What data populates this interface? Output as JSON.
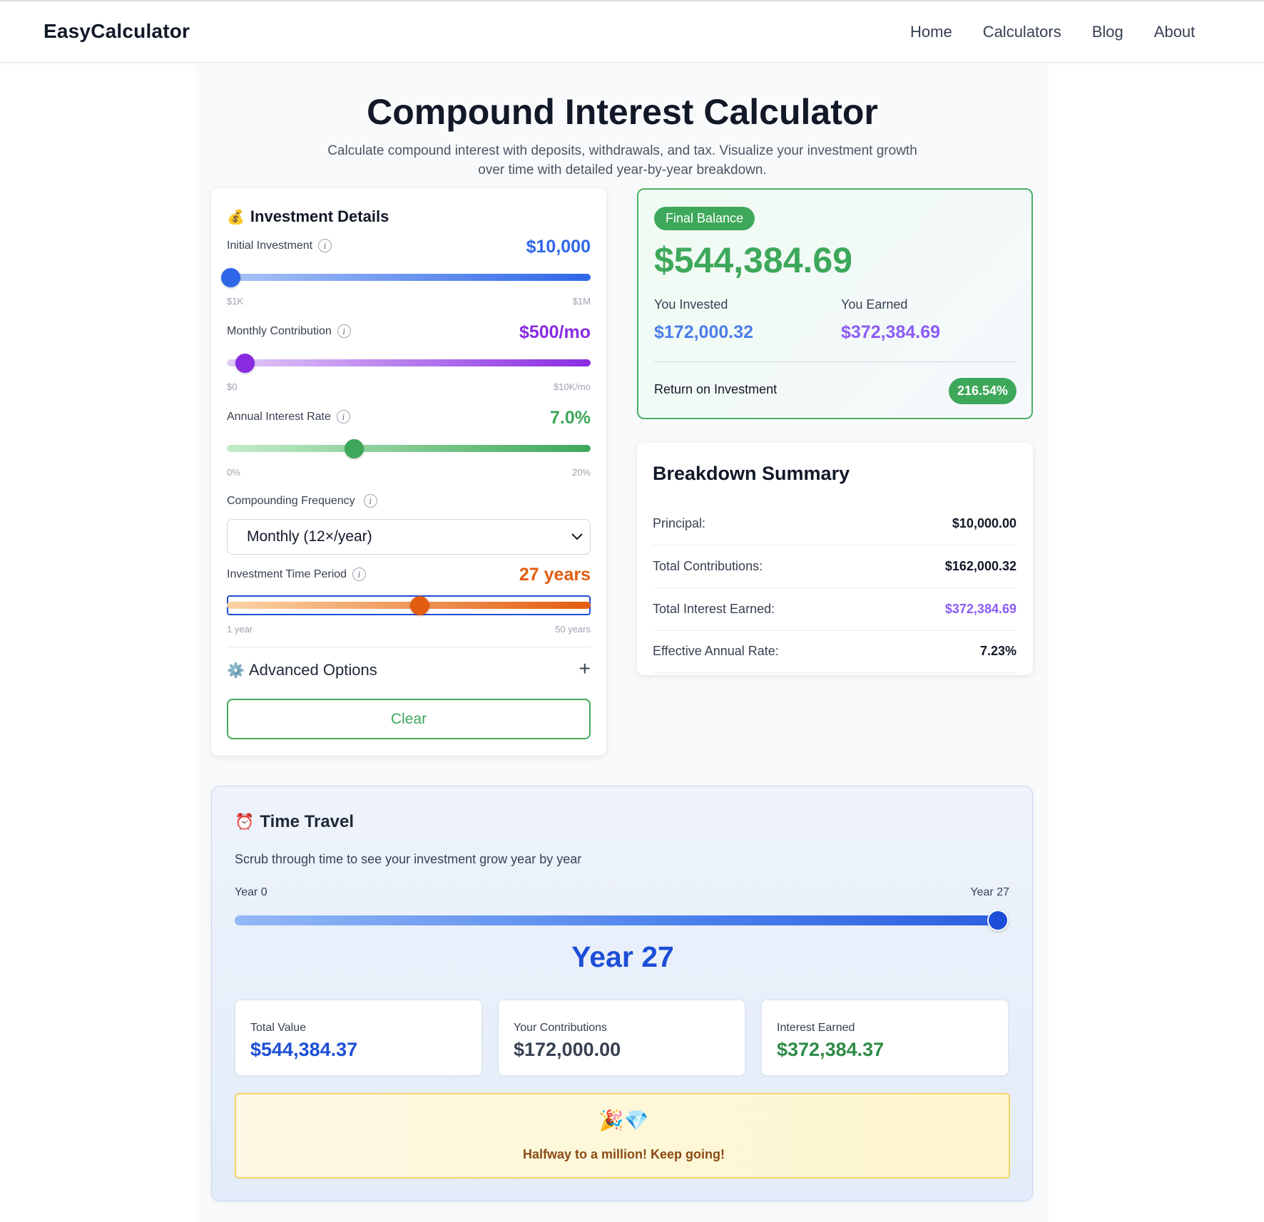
{
  "nav": {
    "brand": "EasyCalculator",
    "links": [
      "Home",
      "Calculators",
      "Blog",
      "About"
    ]
  },
  "header": {
    "title": "Compound Interest Calculator",
    "subtitle_line1": "Calculate compound interest with deposits, withdrawals, and tax. Visualize your investment growth",
    "subtitle_line2": "over time with detailed year-by-year breakdown."
  },
  "investment": {
    "title_emoji": "💰",
    "title": "Investment Details",
    "initial": {
      "label": "Initial Investment",
      "value": "$10,000",
      "min": "$1K",
      "max": "$1M",
      "fraction": 0.01,
      "color": "#2f66e8"
    },
    "monthly": {
      "label": "Monthly Contribution",
      "value": "$500/mo",
      "min": "$0",
      "max": "$10K/mo",
      "fraction": 0.05,
      "color": "#8a2be2"
    },
    "rate": {
      "label": "Annual Interest Rate",
      "value": "7.0%",
      "min": "0%",
      "max": "20%",
      "fraction": 0.35,
      "color": "#3ea85a"
    },
    "frequency": {
      "label": "Compounding Frequency",
      "selected": "Monthly (12×/year)"
    },
    "period": {
      "label": "Investment Time Period",
      "value": "27 years",
      "min": "1 year",
      "max": "50 years",
      "fraction": 0.53,
      "color": "#e25d10"
    },
    "advanced": {
      "emoji": "⚙️",
      "label": "Advanced Options",
      "toggle": "+"
    },
    "clear_label": "Clear"
  },
  "final": {
    "badge": "Final Balance",
    "amount": "$544,384.69",
    "invested_label": "You Invested",
    "invested_value": "$172,000.32",
    "earned_label": "You Earned",
    "earned_value": "$372,384.69",
    "roi_label": "Return on Investment",
    "roi_value": "216.54%"
  },
  "breakdown": {
    "title": "Breakdown Summary",
    "rows": [
      {
        "label": "Principal:",
        "value": "$10,000.00"
      },
      {
        "label": "Total Contributions:",
        "value": "$162,000.32"
      },
      {
        "label": "Total Interest Earned:",
        "value": "$372,384.69"
      },
      {
        "label": "Effective Annual Rate:",
        "value": "7.23%"
      }
    ]
  },
  "time_travel": {
    "emoji": "⏰",
    "title": "Time Travel",
    "subtitle": "Scrub through time to see your investment grow year by year",
    "start_label": "Year 0",
    "end_label": "Year 27",
    "current_year": "Year 27",
    "fraction": 1.0,
    "cards": [
      {
        "label": "Total Value",
        "value": "$544,384.37"
      },
      {
        "label": "Your Contributions",
        "value": "$172,000.00"
      },
      {
        "label": "Interest Earned",
        "value": "$372,384.37"
      }
    ],
    "milestone_emoji": "🎉💎",
    "milestone_text": "Halfway to a million! Keep going!"
  },
  "colors": {
    "blue": "#2f66e8",
    "purple": "#8a2be2",
    "green": "#3ea85a",
    "orange": "#e25d10",
    "earned_purple": "#8b5cf6"
  }
}
